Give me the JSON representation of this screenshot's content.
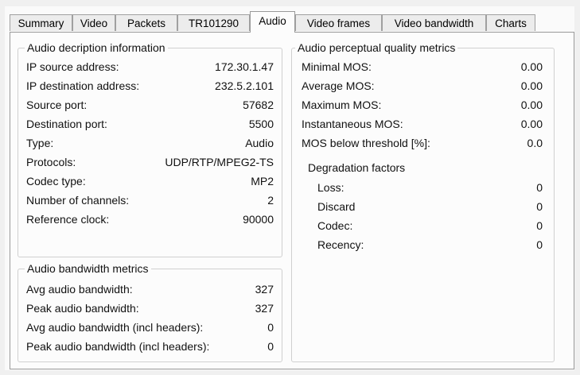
{
  "tabs": [
    "Summary",
    "Video",
    "Packets",
    "TR101290",
    "Audio",
    "Video frames",
    "Video bandwidth",
    "Charts"
  ],
  "active_tab": "Audio",
  "audio_description": {
    "title": "Audio decription information",
    "rows": [
      {
        "label": "IP source address:",
        "value": "172.30.1.47"
      },
      {
        "label": "IP destination address:",
        "value": "232.5.2.101"
      },
      {
        "label": "Source port:",
        "value": "57682"
      },
      {
        "label": "Destination port:",
        "value": "5500"
      },
      {
        "label": "Type:",
        "value": "Audio"
      },
      {
        "label": "Protocols:",
        "value": "UDP/RTP/MPEG2-TS"
      },
      {
        "label": "Codec type:",
        "value": "MP2"
      },
      {
        "label": "Number of channels:",
        "value": "2"
      },
      {
        "label": "Reference clock:",
        "value": "90000"
      }
    ]
  },
  "audio_bandwidth": {
    "title": "Audio bandwidth metrics",
    "rows": [
      {
        "label": "Avg audio bandwidth:",
        "value": "327"
      },
      {
        "label": "Peak audio bandwidth:",
        "value": "327"
      },
      {
        "label": "Avg audio bandwidth (incl headers):",
        "value": "0"
      },
      {
        "label": "Peak audio bandwidth (incl headers):",
        "value": "0"
      }
    ]
  },
  "audio_quality": {
    "title": "Audio perceptual quality metrics",
    "rows": [
      {
        "label": "Minimal MOS:",
        "value": "0.00"
      },
      {
        "label": "Average MOS:",
        "value": "0.00"
      },
      {
        "label": "Maximum MOS:",
        "value": "0.00"
      },
      {
        "label": "Instantaneous MOS:",
        "value": "0.00"
      },
      {
        "label": "MOS below threshold [%]:",
        "value": "0.0"
      }
    ],
    "degradation_title": "Degradation factors",
    "degradation": [
      {
        "label": "Loss:",
        "value": "0"
      },
      {
        "label": "Discard",
        "value": "0"
      },
      {
        "label": "Codec:",
        "value": "0"
      },
      {
        "label": "Recency:",
        "value": "0"
      }
    ]
  }
}
